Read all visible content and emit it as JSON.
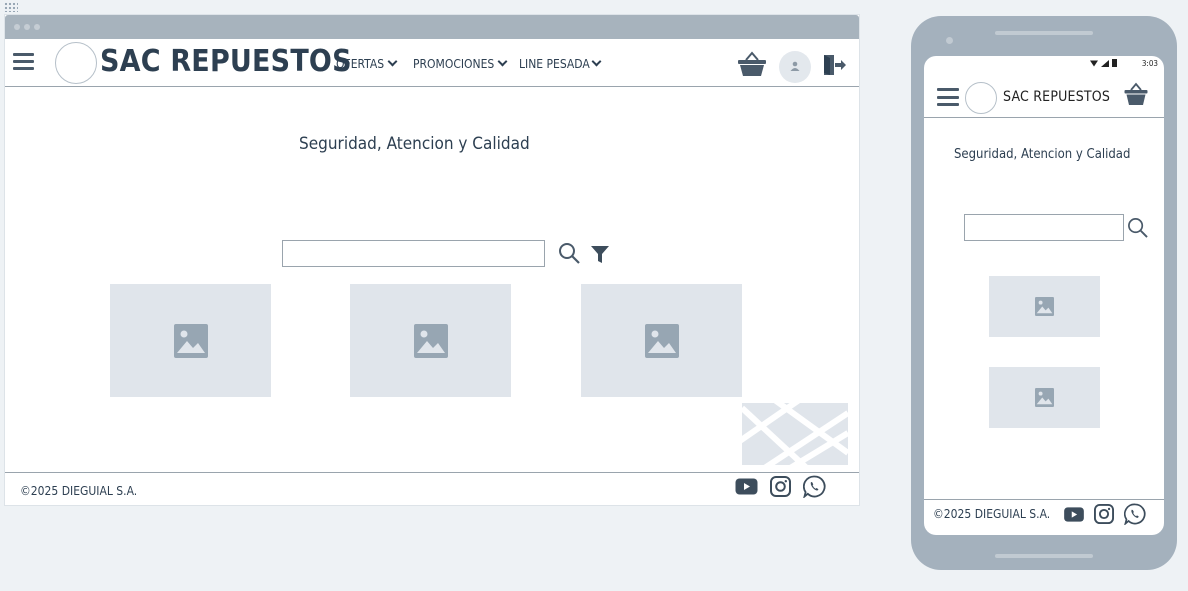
{
  "desktop": {
    "brand": "SAC REPUESTOS",
    "menu": [
      {
        "label": "OFERTAS"
      },
      {
        "label": "PROMOCIONES"
      },
      {
        "label": "LINE PESADA"
      }
    ],
    "tagline": "Seguridad, Atencion y Calidad",
    "search": {
      "value": "",
      "placeholder": ""
    },
    "product_cards": 3,
    "footer": {
      "copyright": "©2025 DIEGUIAL S.A."
    }
  },
  "mobile": {
    "status_time": "3:03",
    "brand": "SAC REPUESTOS",
    "tagline": "Seguridad, Atencion y Calidad",
    "search": {
      "value": "",
      "placeholder": ""
    },
    "product_cards": 2,
    "footer": {
      "copyright": "©2025 DIEGUIAL S.A."
    }
  },
  "icons": [
    "menu-icon",
    "cart-icon",
    "user-icon",
    "logout-icon",
    "search-icon",
    "filter-icon",
    "image-placeholder-icon",
    "youtube-icon",
    "instagram-icon",
    "whatsapp-icon"
  ],
  "colors": {
    "primary": "#2d3f51",
    "chrome": "#a7b3bd",
    "placeholder": "#e0e5eb",
    "icon": "#4a5a6a"
  }
}
